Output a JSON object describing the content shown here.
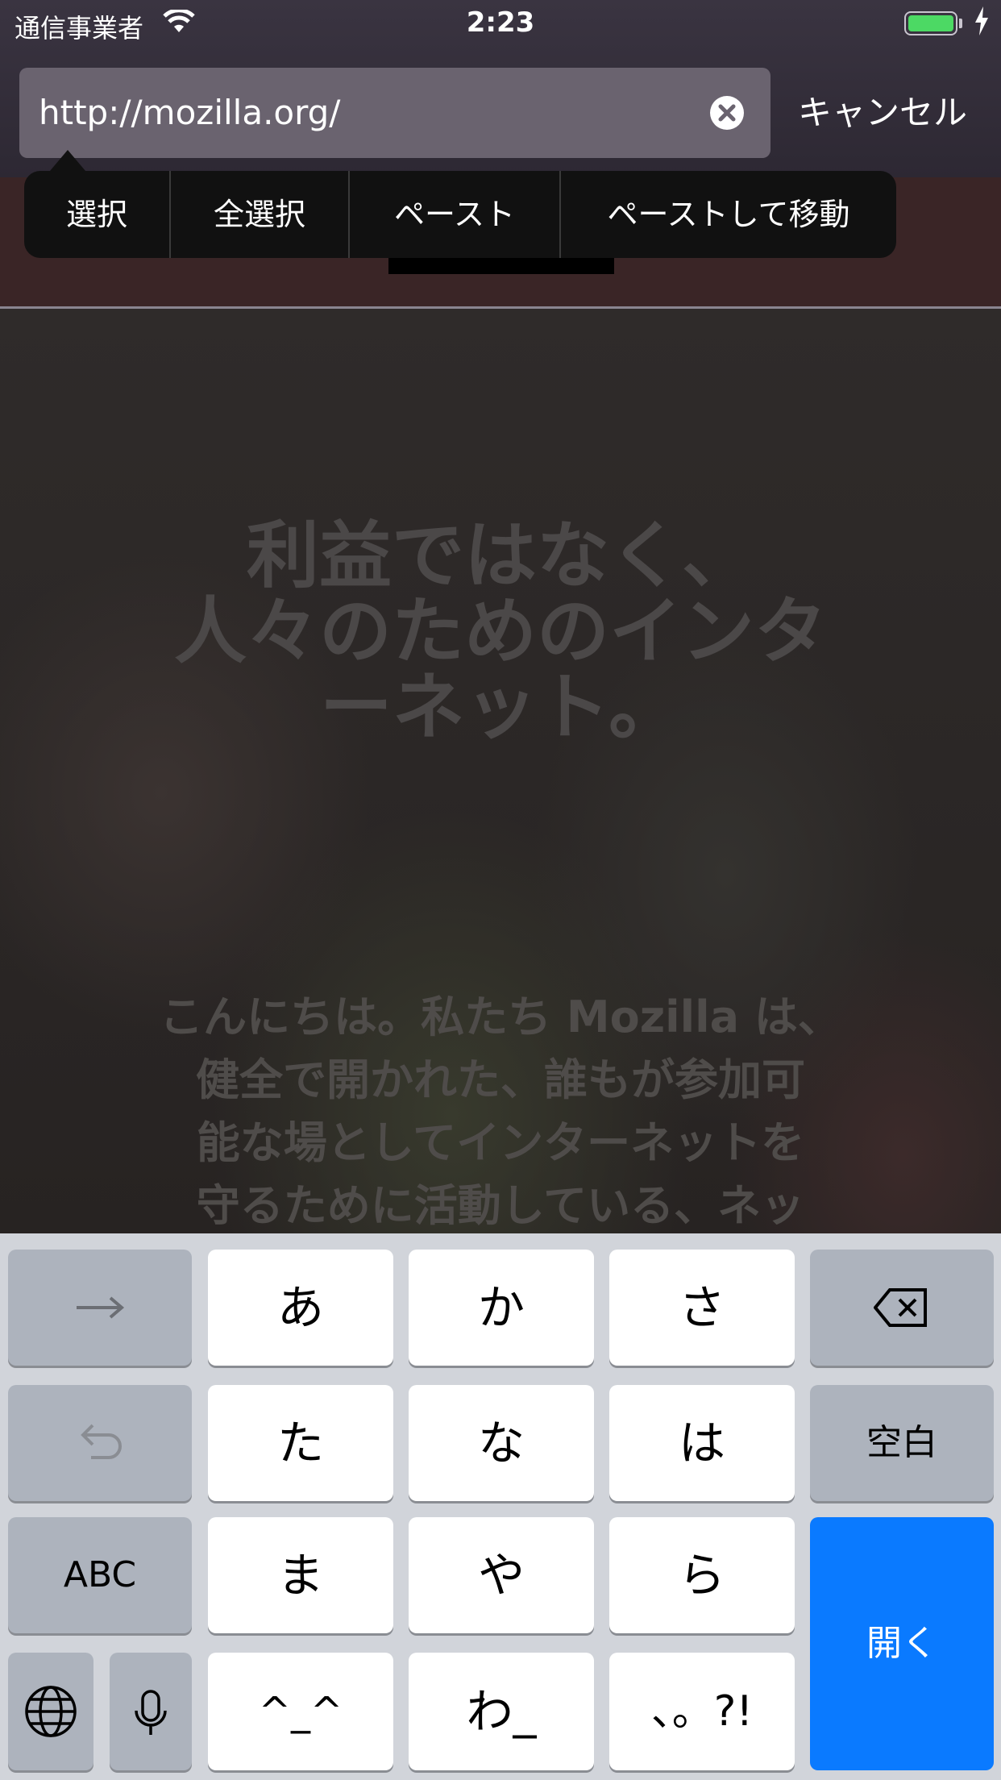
{
  "status_bar": {
    "carrier": "通信事業者",
    "time": "2:23",
    "battery_color": "#4cd964"
  },
  "url_bar": {
    "url": "http://mozilla.org/",
    "cancel_label": "キャンセル"
  },
  "callout_menu": {
    "items": [
      "選択",
      "全選択",
      "ペースト",
      "ペーストして移動"
    ]
  },
  "page": {
    "title": "利益ではなく、\n人々のためのインタ\nーネット。",
    "body": "こんにちは。私たち Mozilla は、\n健全で開かれた、誰もが参加可\n能な場としてインターネットを\n守るために活動している、ネッ"
  },
  "keyboard": {
    "row1": [
      "あ",
      "か",
      "さ"
    ],
    "row2": [
      "た",
      "な",
      "は"
    ],
    "row3": [
      "ま",
      "や",
      "ら"
    ],
    "row4": [
      "^_^",
      "わ_",
      "、。?!"
    ],
    "space_label": "空白",
    "abc_label": "ABC",
    "return_label": "開く",
    "accent_color": "#0a7aff"
  }
}
